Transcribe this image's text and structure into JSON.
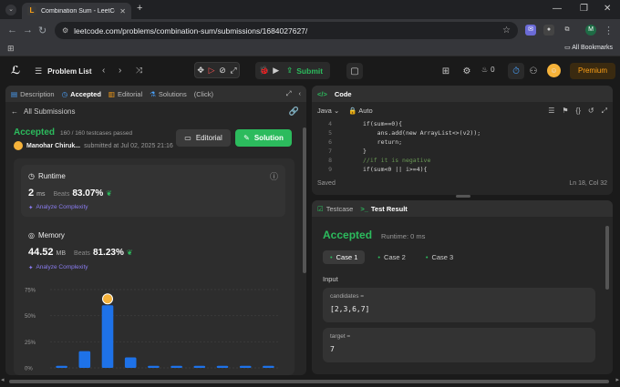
{
  "browser": {
    "tab_title": "Combination Sum - LeetCode",
    "url": "leetcode.com/problems/combination-sum/submissions/1684027627/",
    "bookmarks_label": "All Bookmarks",
    "profile_initial": "M"
  },
  "header": {
    "problem_list": "Problem List",
    "submit": "Submit",
    "streak": "0",
    "premium": "Premium"
  },
  "left_panel": {
    "tabs": {
      "description": "Description",
      "accepted": "Accepted",
      "editorial": "Editorial",
      "solutions": "Solutions",
      "click": "(Click)"
    },
    "back_label": "All Submissions",
    "status": "Accepted",
    "testcases": "160 / 160 testcases passed",
    "user": "Manohar Chiruk...",
    "submitted_at": "submitted at Jul 02, 2025 21:16",
    "editorial_btn": "Editorial",
    "solution_btn": "Solution",
    "runtime": {
      "title": "Runtime",
      "value": "2",
      "unit": "ms",
      "beats_label": "Beats",
      "beats": "83.07%",
      "analyze": "Analyze Complexity"
    },
    "memory": {
      "title": "Memory",
      "value": "44.52",
      "unit": "MB",
      "beats_label": "Beats",
      "beats": "81.23%",
      "analyze": "Analyze Complexity"
    }
  },
  "chart_data": {
    "type": "bar",
    "yticks": [
      "75%",
      "50%",
      "25%",
      "0%"
    ],
    "ylim": [
      0,
      75
    ],
    "values": [
      2,
      16,
      60,
      10,
      2,
      2,
      2,
      2,
      2,
      2
    ],
    "highlight_index": 2
  },
  "code_panel": {
    "title": "Code",
    "language": "Java",
    "mode": "Auto",
    "line_numbers": [
      "4",
      "5",
      "6",
      "7",
      "8",
      "9"
    ],
    "lines": [
      "if(sum==0){",
      "    ans.add(new ArrayList<>(v2));",
      "    return;",
      "}",
      "//if it is negative",
      "if(sum<0 || i>=4){"
    ],
    "saved": "Saved",
    "cursor": "Ln 18, Col 32"
  },
  "test_panel": {
    "testcase_tab": "Testcase",
    "result_tab": "Test Result",
    "status": "Accepted",
    "runtime": "Runtime: 0 ms",
    "cases": [
      "Case 1",
      "Case 2",
      "Case 3"
    ],
    "input_label": "Input",
    "candidates_label": "candidates =",
    "candidates_value": "[2,3,6,7]",
    "target_label": "target =",
    "target_value": "7"
  }
}
